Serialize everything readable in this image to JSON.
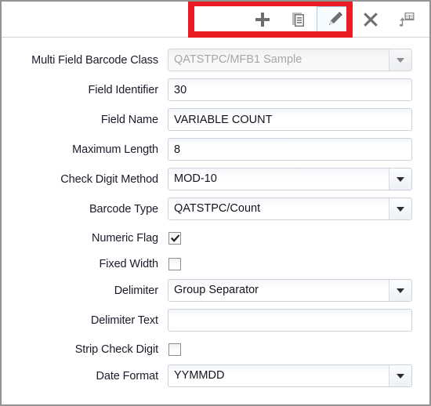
{
  "toolbar": {
    "buttons": [
      {
        "name": "add",
        "icon": "plus-icon",
        "label": "Add",
        "selected": false
      },
      {
        "name": "copy",
        "icon": "copy-document-icon",
        "label": "Copy",
        "selected": false
      },
      {
        "name": "edit",
        "icon": "pencil-icon",
        "label": "Edit",
        "selected": true
      },
      {
        "name": "delete",
        "icon": "close-x-icon",
        "label": "Delete",
        "selected": false
      },
      {
        "name": "export-grid",
        "icon": "export-to-table-icon",
        "label": "Export to Grid",
        "selected": false
      }
    ],
    "highlight_color": "#ec1c24",
    "selected_border_color": "#a8cced"
  },
  "form": {
    "rows": [
      {
        "label": "Multi Field Barcode Class",
        "type": "combo",
        "value": "QATSTPC/MFB1 Sample",
        "disabled": true
      },
      {
        "label": "Field Identifier",
        "type": "text",
        "value": "30",
        "placeholder": ""
      },
      {
        "label": "Field Name",
        "type": "text",
        "value": "VARIABLE COUNT",
        "placeholder": ""
      },
      {
        "label": "Maximum Length",
        "type": "text",
        "value": "8",
        "placeholder": ""
      },
      {
        "label": "Check Digit Method",
        "type": "combo",
        "value": "MOD-10",
        "disabled": false
      },
      {
        "label": "Barcode Type",
        "type": "combo",
        "value": "QATSTPC/Count",
        "disabled": false
      },
      {
        "label": "Numeric Flag",
        "type": "checkbox",
        "checked": true
      },
      {
        "label": "Fixed Width",
        "type": "checkbox",
        "checked": false
      },
      {
        "label": "Delimiter",
        "type": "combo",
        "value": "Group Separator",
        "disabled": false
      },
      {
        "label": "Delimiter Text",
        "type": "text",
        "value": "",
        "placeholder": ""
      },
      {
        "label": "Strip Check Digit",
        "type": "checkbox",
        "checked": false
      },
      {
        "label": "Date Format",
        "type": "combo",
        "value": "YYMMDD",
        "disabled": false
      }
    ]
  }
}
